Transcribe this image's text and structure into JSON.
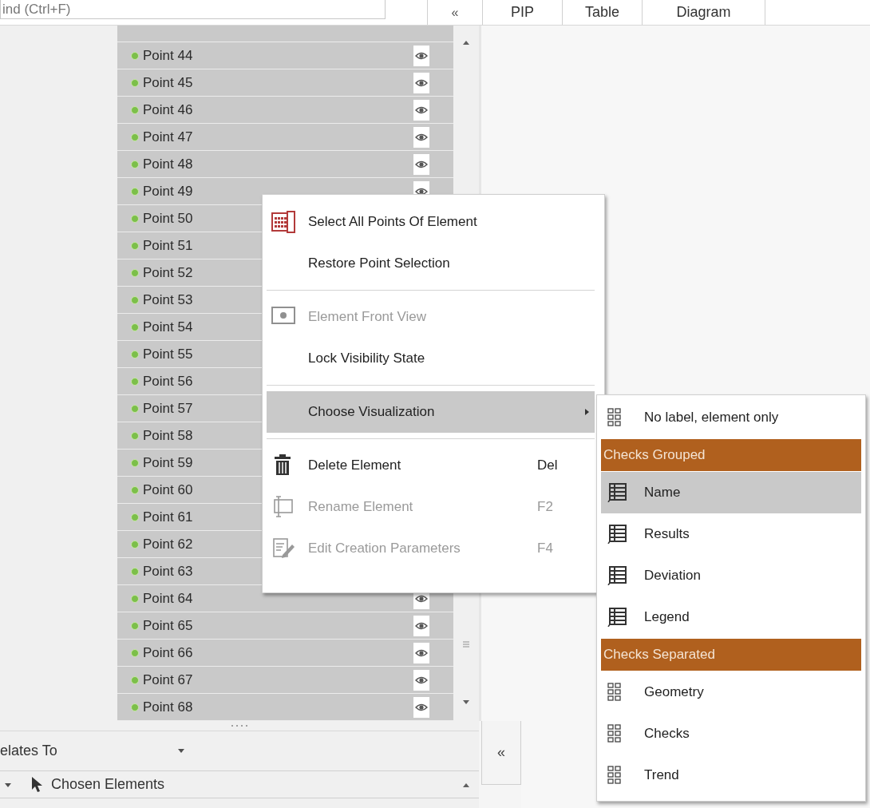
{
  "search": {
    "placeholder": "ind (Ctrl+F)"
  },
  "collapse_button": "«",
  "tabs": [
    {
      "label": "PIP",
      "selected": false
    },
    {
      "label": "Table",
      "selected": false
    },
    {
      "label": "Diagram",
      "selected": false
    }
  ],
  "points": [
    {
      "name": "Point 44",
      "selected": true
    },
    {
      "name": "Point 45",
      "selected": true
    },
    {
      "name": "Point 46",
      "selected": true
    },
    {
      "name": "Point 47",
      "selected": true
    },
    {
      "name": "Point 48",
      "selected": true
    },
    {
      "name": "Point 49",
      "selected": true
    },
    {
      "name": "Point 50",
      "selected": true
    },
    {
      "name": "Point 51",
      "selected": true
    },
    {
      "name": "Point 52",
      "selected": true
    },
    {
      "name": "Point 53",
      "selected": true
    },
    {
      "name": "Point 54",
      "selected": true
    },
    {
      "name": "Point 55",
      "selected": true
    },
    {
      "name": "Point 56",
      "selected": true
    },
    {
      "name": "Point 57",
      "selected": true
    },
    {
      "name": "Point 58",
      "selected": true
    },
    {
      "name": "Point 59",
      "selected": true
    },
    {
      "name": "Point 60",
      "selected": true
    },
    {
      "name": "Point 61",
      "selected": true
    },
    {
      "name": "Point 62",
      "selected": true
    },
    {
      "name": "Point 63",
      "selected": true
    },
    {
      "name": "Point 64",
      "selected": true
    },
    {
      "name": "Point 65",
      "selected": true
    },
    {
      "name": "Point 66",
      "selected": true
    },
    {
      "name": "Point 67",
      "selected": true
    },
    {
      "name": "Point 68",
      "selected": true
    }
  ],
  "relates_to": {
    "label": "elates To"
  },
  "side_collapse_button": "«",
  "tree": [
    {
      "label": "Chosen Elements",
      "expanded": true
    }
  ],
  "context_menu": {
    "groups": [
      [
        {
          "label": "Select All Points Of Element",
          "disabled": false,
          "expanded": false
        },
        {
          "label": "Restore Point Selection",
          "disabled": false,
          "expanded": false
        }
      ],
      [
        {
          "label": "Element Front View",
          "disabled": true,
          "expanded": false
        },
        {
          "label": "Lock Visibility State",
          "disabled": false,
          "expanded": false
        }
      ],
      [
        {
          "label": "Choose Visualization",
          "disabled": false,
          "expanded": true,
          "submenu": true
        }
      ],
      [
        {
          "label": "Delete Element",
          "shortcut": "Del",
          "disabled": false,
          "expanded": false
        },
        {
          "label": "Rename Element",
          "shortcut": "F2",
          "disabled": true,
          "expanded": false
        },
        {
          "label": "Edit Creation Parameters",
          "shortcut": "F4",
          "disabled": true,
          "expanded": false
        }
      ]
    ]
  },
  "submenu": {
    "items": [
      {
        "label": "No label, element only",
        "selected": false
      }
    ],
    "sections": [
      {
        "title": "Checks Grouped",
        "items": [
          {
            "label": "Name",
            "selected": true
          },
          {
            "label": "Results",
            "selected": false
          },
          {
            "label": "Deviation",
            "selected": false
          },
          {
            "label": "Legend",
            "selected": false
          }
        ]
      },
      {
        "title": "Checks Separated",
        "items": [
          {
            "label": "Geometry",
            "selected": false
          },
          {
            "label": "Checks",
            "selected": false
          },
          {
            "label": "Trend",
            "selected": false
          }
        ]
      }
    ]
  }
}
